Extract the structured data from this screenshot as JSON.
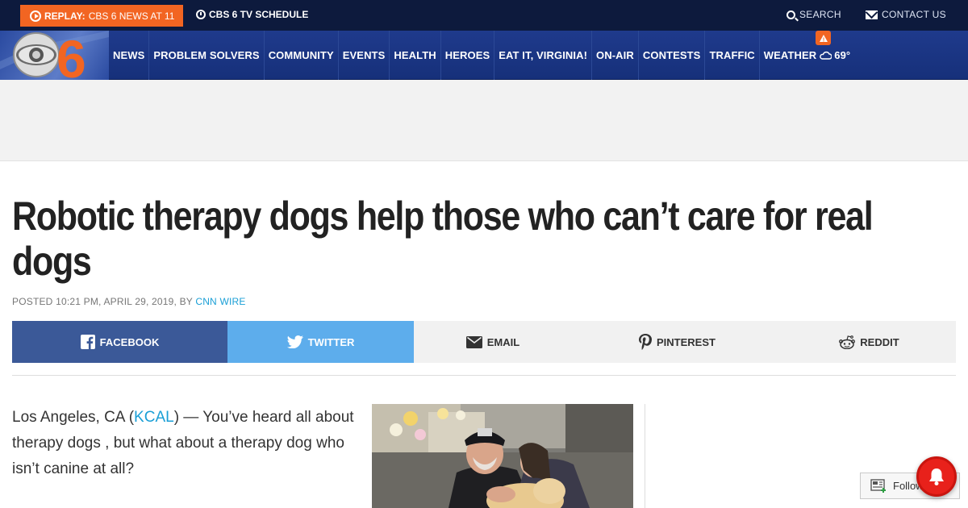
{
  "topbar": {
    "replay_label": "REPLAY:",
    "replay_text": "CBS 6 NEWS AT 11",
    "schedule": "CBS 6 TV SCHEDULE",
    "search": "SEARCH",
    "contact": "CONTACT US"
  },
  "nav": {
    "logo_text": "6",
    "items": [
      "NEWS",
      "PROBLEM SOLVERS",
      "COMMUNITY",
      "EVENTS",
      "HEALTH",
      "HEROES",
      "EAT IT, VIRGINIA!",
      "ON-AIR",
      "CONTESTS",
      "TRAFFIC"
    ],
    "weather_label": "WEATHER",
    "weather_temp": "69°",
    "weather_alert": "!"
  },
  "article": {
    "headline": "Robotic therapy dogs help those who can’t care for real dogs",
    "byline_prefix": "POSTED 10:21 PM, APRIL 29, 2019, BY",
    "byline_author": "CNN WIRE",
    "lede_start": "Los Angeles, CA (",
    "lede_link": "KCAL",
    "lede_end": ") — You’ve heard all about therapy dogs , but what about a therapy dog who isn’t canine at all?"
  },
  "share": {
    "facebook": "FACEBOOK",
    "twitter": "TWITTER",
    "email": "EMAIL",
    "pinterest": "PINTEREST",
    "reddit": "REDDIT"
  },
  "widgets": {
    "follow": "Follow"
  },
  "colors": {
    "topbar": "#0d1a3d",
    "nav": "#1f3a8c",
    "replay": "#f26522",
    "link": "#1a9fd6",
    "facebook": "#3b5998",
    "twitter": "#5dadec",
    "bell": "#e8211b"
  }
}
